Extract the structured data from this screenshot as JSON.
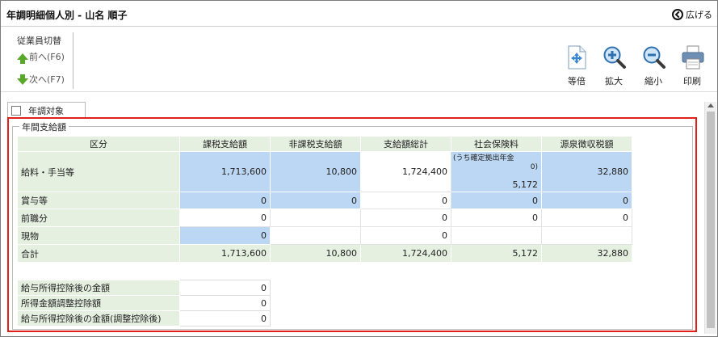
{
  "window": {
    "title": "年調明細個人別 - 山名 順子",
    "expand_label": "広げる"
  },
  "toolbar": {
    "employee_switch_label": "従業員切替",
    "prev_label": "前へ(F6)",
    "next_label": "次へ(F7)",
    "fit_label": "等倍",
    "zoom_in_label": "拡大",
    "zoom_out_label": "縮小",
    "print_label": "印刷"
  },
  "tab": {
    "label": "年調対象"
  },
  "section": {
    "legend": "年間支給額"
  },
  "table": {
    "headers": [
      "区分",
      "課税支給額",
      "非課税支給額",
      "支給額総計",
      "社会保険料",
      "源泉徴収税額"
    ],
    "social_note": "(うち確定拠出年金",
    "social_note2": "0)",
    "rows": [
      {
        "label": "給料・手当等",
        "taxable": "1,713,600",
        "nontaxable": "10,800",
        "total": "1,724,400",
        "social": "5,172",
        "withholding": "32,880"
      },
      {
        "label": "賞与等",
        "taxable": "0",
        "nontaxable": "0",
        "total": "0",
        "social": "0",
        "withholding": "0"
      },
      {
        "label": "前職分",
        "taxable": "0",
        "nontaxable": "",
        "total": "0",
        "social": "0",
        "withholding": "0"
      },
      {
        "label": "現物",
        "taxable": "0",
        "nontaxable": "",
        "total": "0",
        "social": "",
        "withholding": ""
      },
      {
        "label": "合計",
        "taxable": "1,713,600",
        "nontaxable": "10,800",
        "total": "1,724,400",
        "social": "5,172",
        "withholding": "32,880"
      }
    ]
  },
  "deduction_table": {
    "rows": [
      {
        "label": "給与所得控除後の金額",
        "value": "0"
      },
      {
        "label": "所得金額調整控除額",
        "value": "0"
      },
      {
        "label": "給与所得控除後の金額(調整控除後)",
        "value": "0"
      }
    ]
  },
  "colors": {
    "highlight": "#e0201a",
    "input_blue": "#bcd7f3",
    "header_green": "#e5f0e1",
    "arrow_green": "#5aa82a"
  }
}
